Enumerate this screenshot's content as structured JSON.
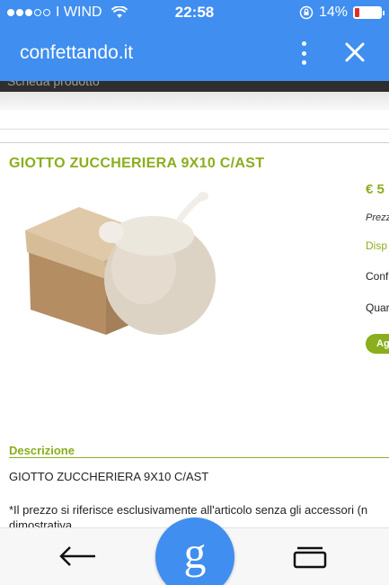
{
  "status_bar": {
    "carrier": "I WIND",
    "time": "22:58",
    "battery_percent": "14%",
    "signal_bars_filled": 3,
    "signal_bars_total": 5
  },
  "app_bar": {
    "site": "confettando.it"
  },
  "breadcrumb_partial": "Scheda prodotto",
  "product": {
    "title": "GIOTTO ZUCCHERIERA 9X10 C/AST",
    "price": "€ 5",
    "price_note": "Prezz",
    "availability": "Disp",
    "conf": "Conf",
    "quantity": "Quar",
    "add_label": "Ag"
  },
  "description": {
    "heading": "Descrizione",
    "line": "GIOTTO ZUCCHERIERA 9X10 C/AST",
    "note": "*Il prezzo si riferisce esclusivamente all'articolo senza gli accessori (n",
    "note_cont": "dimostrativa"
  },
  "bottom_nav": {
    "google_letter": "g"
  },
  "colors": {
    "accent_blue": "#3f8ef0",
    "brand_green": "#8aae1d",
    "battery_low": "#e0302a"
  },
  "icons": [
    "wifi-icon",
    "rotation-lock-icon",
    "battery-icon",
    "overflow-menu-icon",
    "close-icon",
    "back-arrow-icon",
    "google-search-icon",
    "tabs-icon"
  ]
}
